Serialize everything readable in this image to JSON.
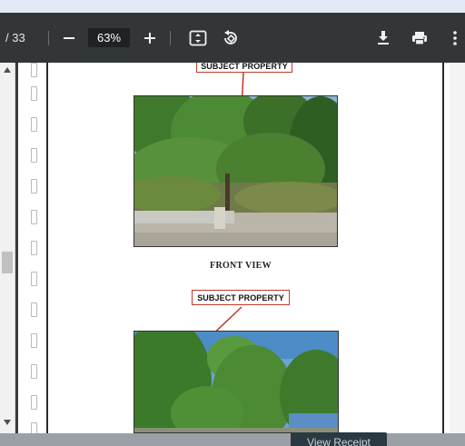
{
  "toolbar": {
    "page_count": "/ 33",
    "zoom": "63%"
  },
  "document": {
    "label_top": "SUBJECT PROPERTY",
    "caption": "FRONT VIEW",
    "label_second": "SUBJECT PROPERTY"
  },
  "footer": {
    "view_receipt": "View Receipt"
  },
  "colors": {
    "toolbar_bg": "#323639",
    "viewer_bg": "#525659",
    "label_border": "#c0392b"
  }
}
